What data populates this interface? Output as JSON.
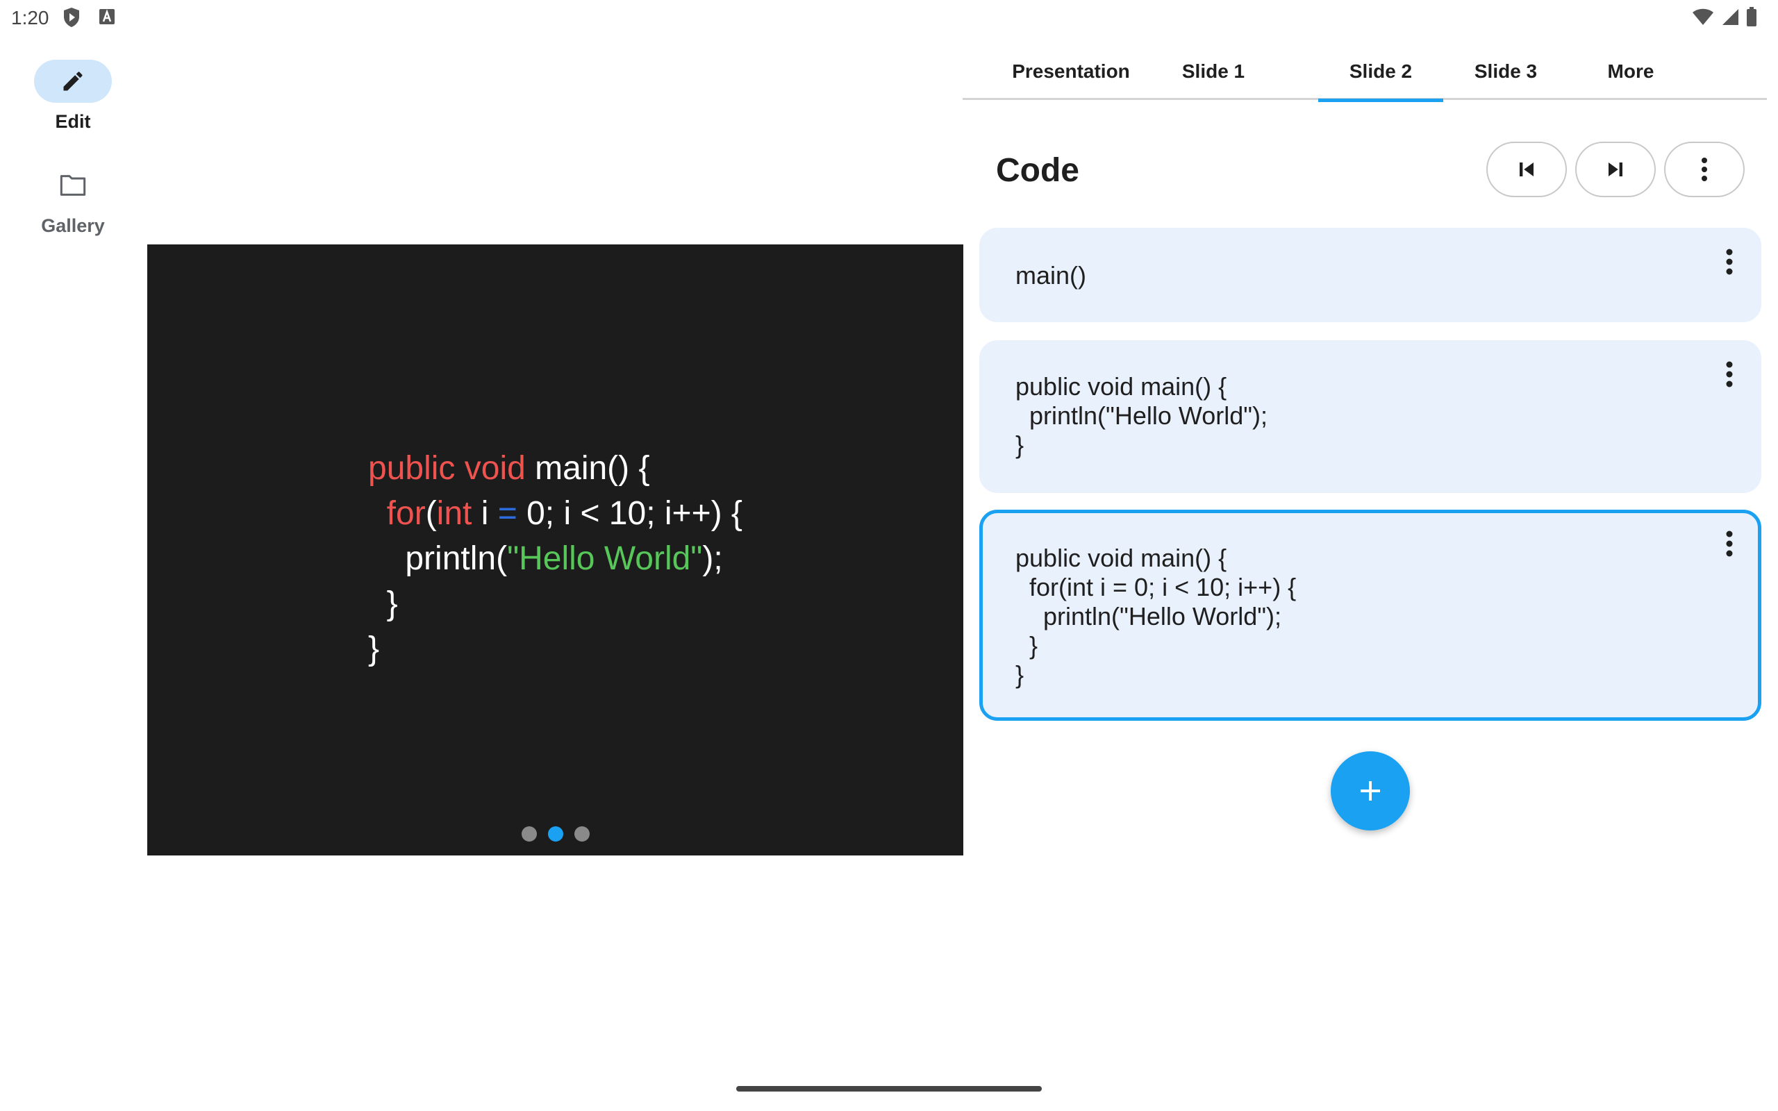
{
  "status_bar": {
    "time": "1:20"
  },
  "nav": {
    "edit_label": "Edit",
    "gallery_label": "Gallery"
  },
  "tabs": [
    {
      "label": "Presentation"
    },
    {
      "label": "Slide 1"
    },
    {
      "label": "Slide 2",
      "active": true
    },
    {
      "label": "Slide 3"
    },
    {
      "label": "More"
    }
  ],
  "header": {
    "title": "Code"
  },
  "slide": {
    "code_lines": [
      [
        {
          "t": "public void ",
          "c": "kw"
        },
        {
          "t": "main() {",
          "c": ""
        }
      ],
      [
        {
          "t": "  for",
          "c": "kw"
        },
        {
          "t": "(",
          "c": ""
        },
        {
          "t": "int ",
          "c": "kw"
        },
        {
          "t": "i ",
          "c": ""
        },
        {
          "t": "=",
          "c": "op"
        },
        {
          "t": " 0; i < 10; i++) {",
          "c": ""
        }
      ],
      [
        {
          "t": "    println(",
          "c": ""
        },
        {
          "t": "\"Hello World\"",
          "c": "str"
        },
        {
          "t": ");",
          "c": ""
        }
      ],
      [
        {
          "t": "  }",
          "c": ""
        }
      ],
      [
        {
          "t": "}",
          "c": ""
        }
      ]
    ],
    "pages": 3,
    "current_page": 2
  },
  "cards": [
    {
      "text": "main()"
    },
    {
      "text": "public void main() {\n  println(\"Hello World\");\n}"
    },
    {
      "text": "public void main() {\n  for(int i = 0; i < 10; i++) {\n    println(\"Hello World\");\n  }\n}",
      "selected": true
    }
  ],
  "colors": {
    "accent": "#1ba1f2",
    "keyword": "#ef5350",
    "string": "#57c75a",
    "operator": "#2d6cdf"
  }
}
